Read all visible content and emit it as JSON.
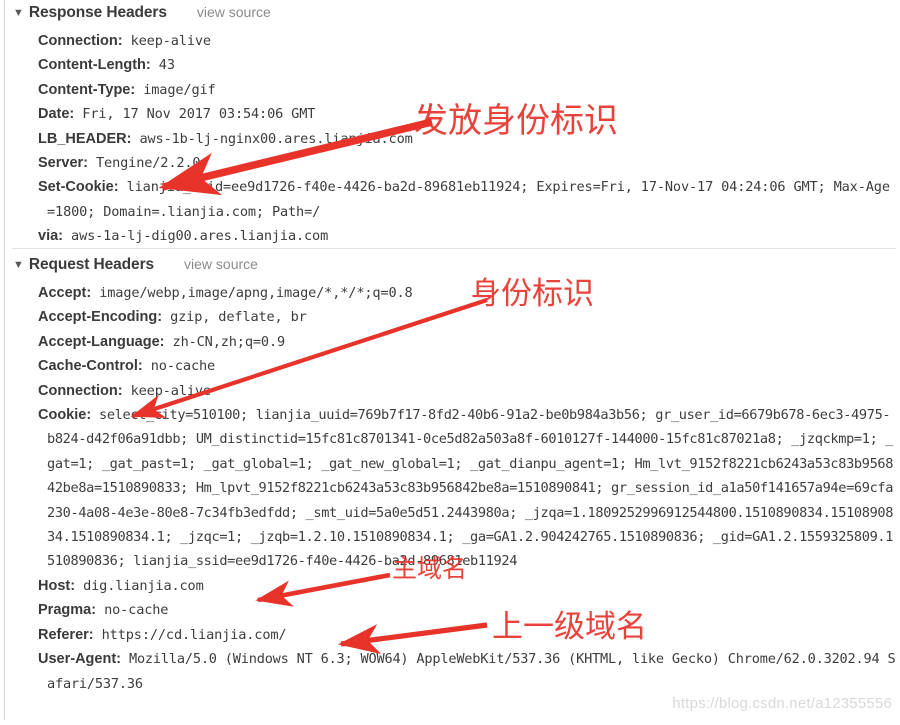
{
  "panel": {
    "watermark": "https://blog.csdn.net/a12355556",
    "twisty_glyph": "▼",
    "accent_red": "#e8332a",
    "text_color": "#3d3d3d"
  },
  "sections": [
    {
      "id": "response",
      "title": "Response Headers",
      "view_source_label": "view source",
      "headers": [
        {
          "name": "Connection:",
          "value": " keep-alive"
        },
        {
          "name": "Content-Length:",
          "value": " 43"
        },
        {
          "name": "Content-Type:",
          "value": " image/gif"
        },
        {
          "name": "Date:",
          "value": " Fri, 17 Nov 2017 03:54:06 GMT"
        },
        {
          "name": "LB_HEADER:",
          "value": " aws-1b-lj-nginx00.ares.lianjia.com"
        },
        {
          "name": "Server:",
          "value": " Tengine/2.2.0"
        },
        {
          "name": "Set-Cookie:",
          "value": " lianjia_ssid=ee9d1726-f40e-4426-ba2d-89681eb11924; Expires=Fri, 17-Nov-17 04:24:06 GMT; Max-Age=1800; Domain=.lianjia.com; Path=/"
        },
        {
          "name": "via:",
          "value": " aws-1a-lj-dig00.ares.lianjia.com"
        }
      ]
    },
    {
      "id": "request",
      "title": "Request Headers",
      "view_source_label": "view source",
      "headers": [
        {
          "name": "Accept:",
          "value": " image/webp,image/apng,image/*,*/*;q=0.8"
        },
        {
          "name": "Accept-Encoding:",
          "value": " gzip, deflate, br"
        },
        {
          "name": "Accept-Language:",
          "value": " zh-CN,zh;q=0.9"
        },
        {
          "name": "Cache-Control:",
          "value": " no-cache"
        },
        {
          "name": "Connection:",
          "value": " keep-alive"
        },
        {
          "name": "Cookie:",
          "value": " select_city=510100; lianjia_uuid=769b7f17-8fd2-40b6-91a2-be0b984a3b56; gr_user_id=6679b678-6ec3-4975-b824-d42f06a91dbb; UM_distinctid=15fc81c8701341-0ce5d82a503a8f-6010127f-144000-15fc81c87021a8; _jzqckmp=1; _gat=1; _gat_past=1; _gat_global=1; _gat_new_global=1; _gat_dianpu_agent=1; Hm_lvt_9152f8221cb6243a53c83b956842be8a=1510890833; Hm_lpvt_9152f8221cb6243a53c83b956842be8a=1510890841; gr_session_id_a1a50f141657a94e=69cfa230-4a08-4e3e-80e8-7c34fb3edfdd; _smt_uid=5a0e5d51.2443980a; _jzqa=1.1809252996912544800.1510890834.1510890834.1510890834.1; _jzqc=1; _jzqb=1.2.10.1510890834.1; _ga=GA1.2.904242765.1510890836; _gid=GA1.2.1559325809.1510890836; lianjia_ssid=ee9d1726-f40e-4426-ba2d-89681eb11924"
        },
        {
          "name": "Host:",
          "value": " dig.lianjia.com"
        },
        {
          "name": "Pragma:",
          "value": " no-cache"
        },
        {
          "name": "Referer:",
          "value": " https://cd.lianjia.com/"
        },
        {
          "name": "User-Agent:",
          "value": " Mozilla/5.0 (Windows NT 6.3; WOW64) AppleWebKit/537.36 (KHTML, like Gecko) Chrome/62.0.3202.94 Safari/537.36"
        }
      ]
    }
  ],
  "annotations": [
    {
      "id": "anno-1",
      "text": "发放身份标识",
      "target": "set-cookie-header"
    },
    {
      "id": "anno-2",
      "text": "身份标识",
      "target": "cookie-header"
    },
    {
      "id": "anno-3",
      "text": "主域名",
      "target": "host-header"
    },
    {
      "id": "anno-4",
      "text": "上一级域名",
      "target": "referer-header"
    }
  ]
}
